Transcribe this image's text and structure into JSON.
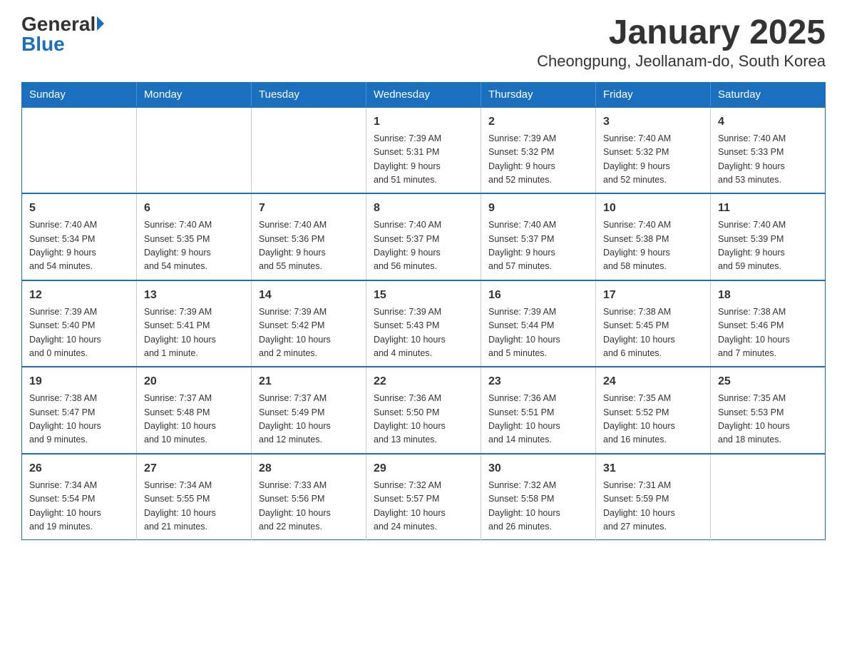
{
  "header": {
    "logo_general": "General",
    "logo_blue": "Blue",
    "title": "January 2025",
    "subtitle": "Cheongpung, Jeollanam-do, South Korea"
  },
  "calendar": {
    "days_of_week": [
      "Sunday",
      "Monday",
      "Tuesday",
      "Wednesday",
      "Thursday",
      "Friday",
      "Saturday"
    ],
    "weeks": [
      [
        {
          "day": "",
          "info": ""
        },
        {
          "day": "",
          "info": ""
        },
        {
          "day": "",
          "info": ""
        },
        {
          "day": "1",
          "info": "Sunrise: 7:39 AM\nSunset: 5:31 PM\nDaylight: 9 hours\nand 51 minutes."
        },
        {
          "day": "2",
          "info": "Sunrise: 7:39 AM\nSunset: 5:32 PM\nDaylight: 9 hours\nand 52 minutes."
        },
        {
          "day": "3",
          "info": "Sunrise: 7:40 AM\nSunset: 5:32 PM\nDaylight: 9 hours\nand 52 minutes."
        },
        {
          "day": "4",
          "info": "Sunrise: 7:40 AM\nSunset: 5:33 PM\nDaylight: 9 hours\nand 53 minutes."
        }
      ],
      [
        {
          "day": "5",
          "info": "Sunrise: 7:40 AM\nSunset: 5:34 PM\nDaylight: 9 hours\nand 54 minutes."
        },
        {
          "day": "6",
          "info": "Sunrise: 7:40 AM\nSunset: 5:35 PM\nDaylight: 9 hours\nand 54 minutes."
        },
        {
          "day": "7",
          "info": "Sunrise: 7:40 AM\nSunset: 5:36 PM\nDaylight: 9 hours\nand 55 minutes."
        },
        {
          "day": "8",
          "info": "Sunrise: 7:40 AM\nSunset: 5:37 PM\nDaylight: 9 hours\nand 56 minutes."
        },
        {
          "day": "9",
          "info": "Sunrise: 7:40 AM\nSunset: 5:37 PM\nDaylight: 9 hours\nand 57 minutes."
        },
        {
          "day": "10",
          "info": "Sunrise: 7:40 AM\nSunset: 5:38 PM\nDaylight: 9 hours\nand 58 minutes."
        },
        {
          "day": "11",
          "info": "Sunrise: 7:40 AM\nSunset: 5:39 PM\nDaylight: 9 hours\nand 59 minutes."
        }
      ],
      [
        {
          "day": "12",
          "info": "Sunrise: 7:39 AM\nSunset: 5:40 PM\nDaylight: 10 hours\nand 0 minutes."
        },
        {
          "day": "13",
          "info": "Sunrise: 7:39 AM\nSunset: 5:41 PM\nDaylight: 10 hours\nand 1 minute."
        },
        {
          "day": "14",
          "info": "Sunrise: 7:39 AM\nSunset: 5:42 PM\nDaylight: 10 hours\nand 2 minutes."
        },
        {
          "day": "15",
          "info": "Sunrise: 7:39 AM\nSunset: 5:43 PM\nDaylight: 10 hours\nand 4 minutes."
        },
        {
          "day": "16",
          "info": "Sunrise: 7:39 AM\nSunset: 5:44 PM\nDaylight: 10 hours\nand 5 minutes."
        },
        {
          "day": "17",
          "info": "Sunrise: 7:38 AM\nSunset: 5:45 PM\nDaylight: 10 hours\nand 6 minutes."
        },
        {
          "day": "18",
          "info": "Sunrise: 7:38 AM\nSunset: 5:46 PM\nDaylight: 10 hours\nand 7 minutes."
        }
      ],
      [
        {
          "day": "19",
          "info": "Sunrise: 7:38 AM\nSunset: 5:47 PM\nDaylight: 10 hours\nand 9 minutes."
        },
        {
          "day": "20",
          "info": "Sunrise: 7:37 AM\nSunset: 5:48 PM\nDaylight: 10 hours\nand 10 minutes."
        },
        {
          "day": "21",
          "info": "Sunrise: 7:37 AM\nSunset: 5:49 PM\nDaylight: 10 hours\nand 12 minutes."
        },
        {
          "day": "22",
          "info": "Sunrise: 7:36 AM\nSunset: 5:50 PM\nDaylight: 10 hours\nand 13 minutes."
        },
        {
          "day": "23",
          "info": "Sunrise: 7:36 AM\nSunset: 5:51 PM\nDaylight: 10 hours\nand 14 minutes."
        },
        {
          "day": "24",
          "info": "Sunrise: 7:35 AM\nSunset: 5:52 PM\nDaylight: 10 hours\nand 16 minutes."
        },
        {
          "day": "25",
          "info": "Sunrise: 7:35 AM\nSunset: 5:53 PM\nDaylight: 10 hours\nand 18 minutes."
        }
      ],
      [
        {
          "day": "26",
          "info": "Sunrise: 7:34 AM\nSunset: 5:54 PM\nDaylight: 10 hours\nand 19 minutes."
        },
        {
          "day": "27",
          "info": "Sunrise: 7:34 AM\nSunset: 5:55 PM\nDaylight: 10 hours\nand 21 minutes."
        },
        {
          "day": "28",
          "info": "Sunrise: 7:33 AM\nSunset: 5:56 PM\nDaylight: 10 hours\nand 22 minutes."
        },
        {
          "day": "29",
          "info": "Sunrise: 7:32 AM\nSunset: 5:57 PM\nDaylight: 10 hours\nand 24 minutes."
        },
        {
          "day": "30",
          "info": "Sunrise: 7:32 AM\nSunset: 5:58 PM\nDaylight: 10 hours\nand 26 minutes."
        },
        {
          "day": "31",
          "info": "Sunrise: 7:31 AM\nSunset: 5:59 PM\nDaylight: 10 hours\nand 27 minutes."
        },
        {
          "day": "",
          "info": ""
        }
      ]
    ]
  }
}
